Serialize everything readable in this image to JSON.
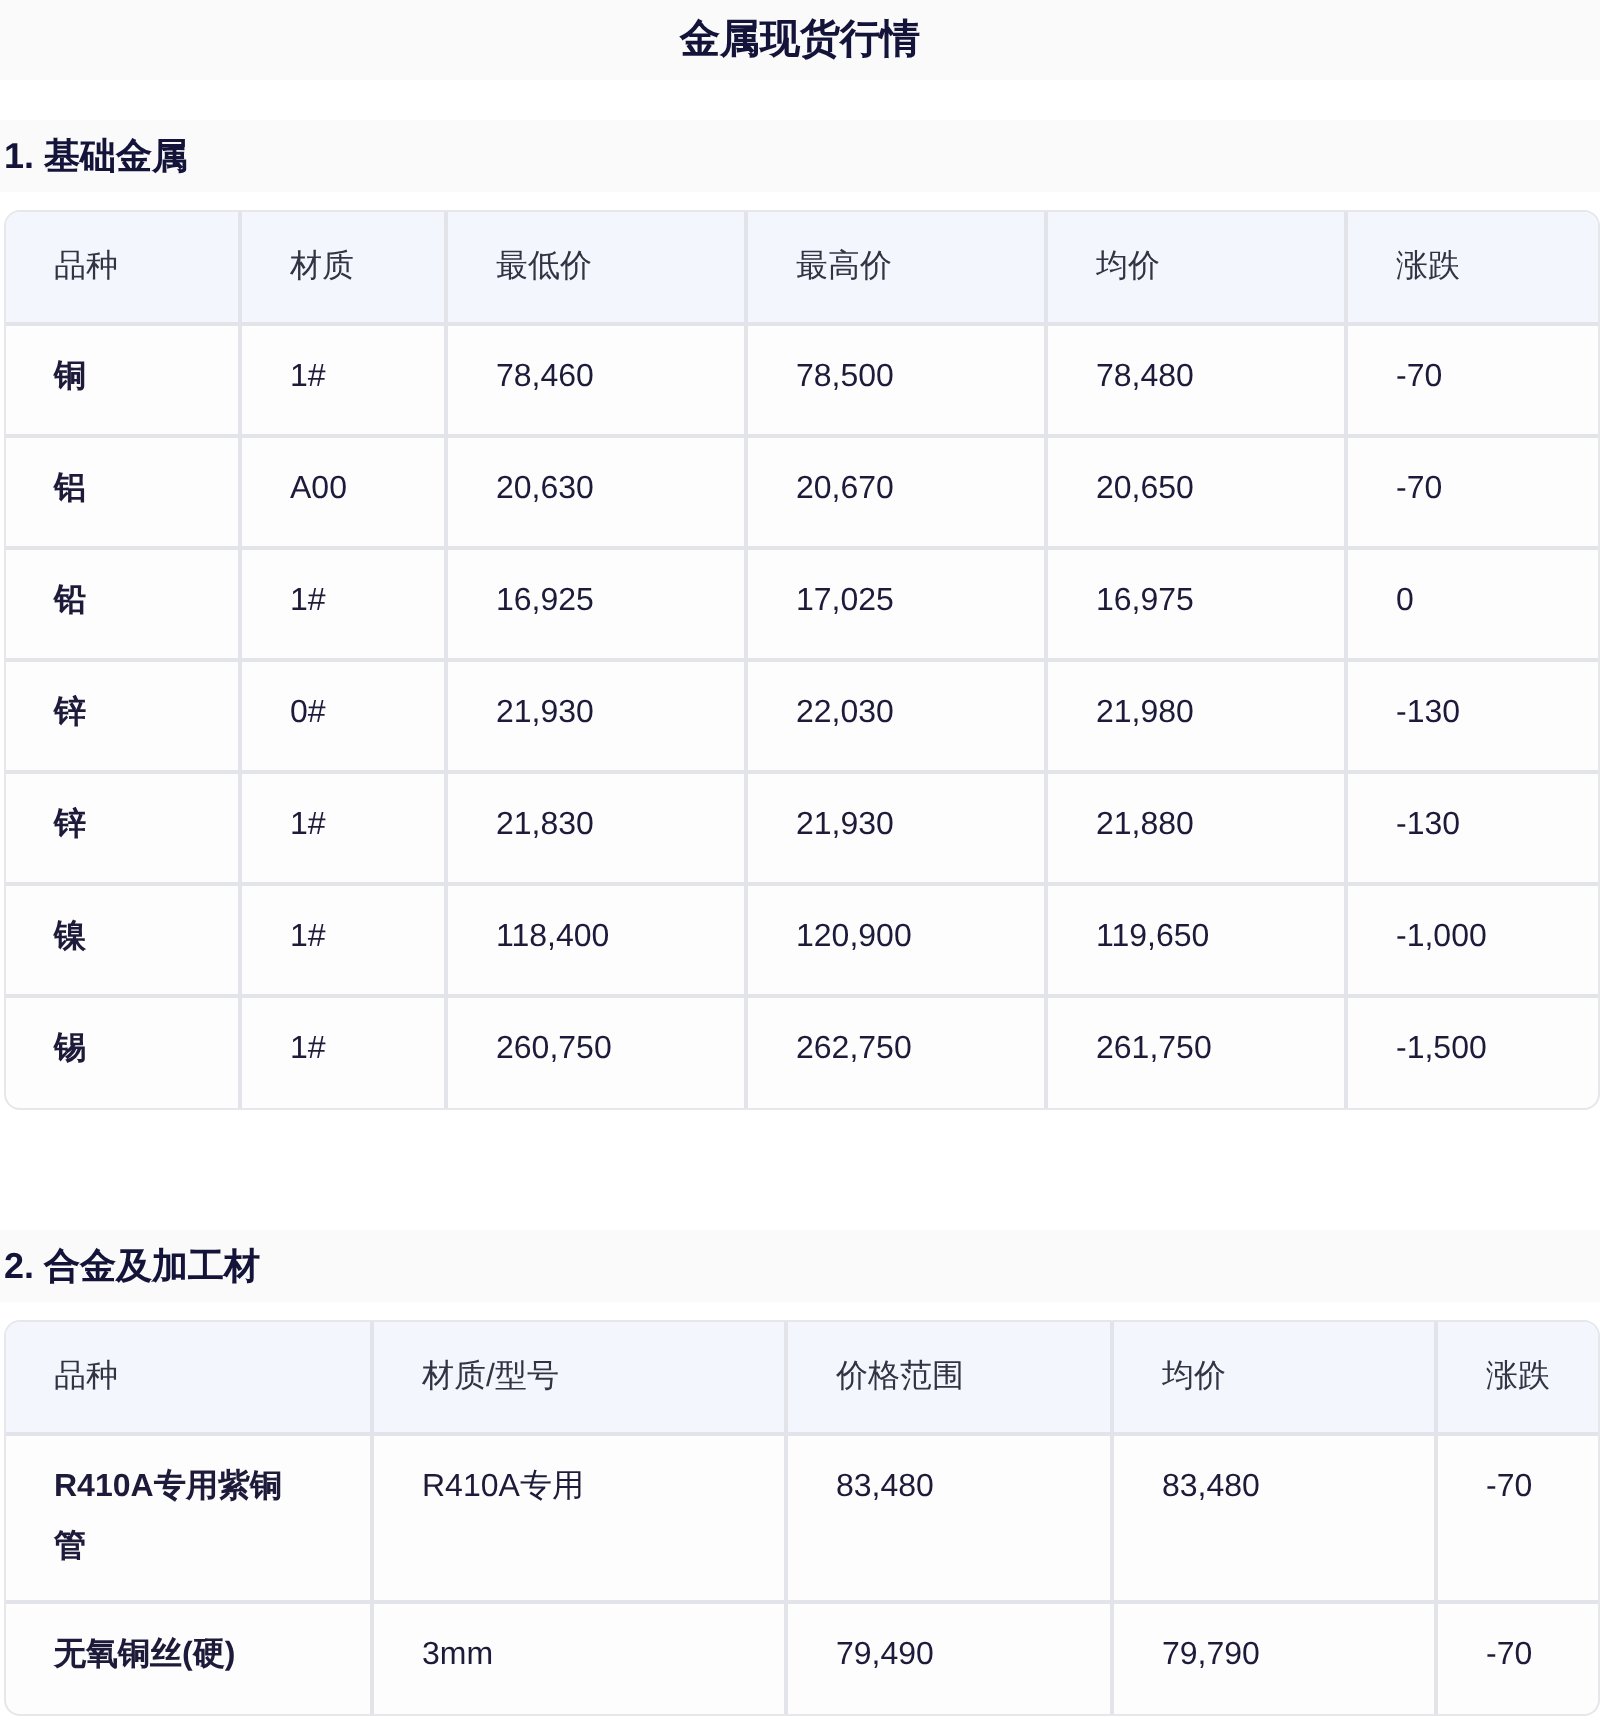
{
  "title": "金属现货行情",
  "sections": [
    {
      "heading": "1. 基础金属",
      "columns": [
        "品种",
        "材质",
        "最低价",
        "最高价",
        "均价",
        "涨跌"
      ],
      "rows": [
        [
          "铜",
          "1#",
          "78,460",
          "78,500",
          "78,480",
          "-70"
        ],
        [
          "铝",
          "A00",
          "20,630",
          "20,670",
          "20,650",
          "-70"
        ],
        [
          "铅",
          "1#",
          "16,925",
          "17,025",
          "16,975",
          "0"
        ],
        [
          "锌",
          "0#",
          "21,930",
          "22,030",
          "21,980",
          "-130"
        ],
        [
          "锌",
          "1#",
          "21,830",
          "21,930",
          "21,880",
          "-130"
        ],
        [
          "镍",
          "1#",
          "118,400",
          "120,900",
          "119,650",
          "-1,000"
        ],
        [
          "锡",
          "1#",
          "260,750",
          "262,750",
          "261,750",
          "-1,500"
        ]
      ]
    },
    {
      "heading": "2. 合金及加工材",
      "columns": [
        "品种",
        "材质/型号",
        "价格范围",
        "均价",
        "涨跌"
      ],
      "rows": [
        [
          "R410A专用紫铜管",
          "R410A专用",
          "83,480",
          "83,480",
          "-70"
        ],
        [
          "无氧铜丝(硬)",
          "3mm",
          "79,490",
          "79,790",
          "-70"
        ]
      ]
    }
  ]
}
